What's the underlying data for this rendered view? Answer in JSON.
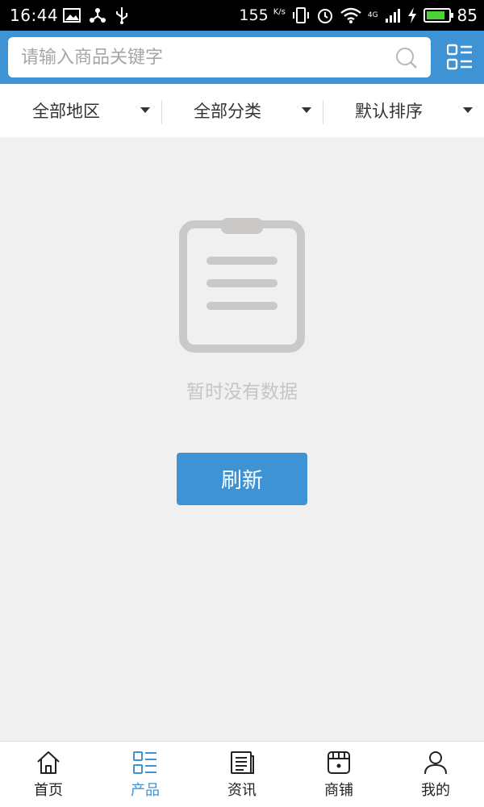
{
  "status_bar": {
    "time": "16:44",
    "speed": "155",
    "speed_unit": "K/s",
    "network": "4G",
    "battery": "85",
    "battery_level": 0.85
  },
  "search": {
    "placeholder": "请输入商品关键字"
  },
  "filters": [
    {
      "label": "全部地区"
    },
    {
      "label": "全部分类"
    },
    {
      "label": "默认排序"
    }
  ],
  "empty_state": {
    "message": "暂时没有数据",
    "refresh_label": "刷新"
  },
  "bottom_nav": {
    "items": [
      {
        "label": "首页",
        "icon": "home-icon"
      },
      {
        "label": "产品",
        "icon": "product-list-icon"
      },
      {
        "label": "资讯",
        "icon": "news-icon"
      },
      {
        "label": "商铺",
        "icon": "shop-icon"
      },
      {
        "label": "我的",
        "icon": "profile-icon"
      }
    ],
    "active_index": 1
  },
  "colors": {
    "accent": "#3d93d4",
    "background": "#f0f0f0",
    "empty_text": "#c5c5c5"
  }
}
